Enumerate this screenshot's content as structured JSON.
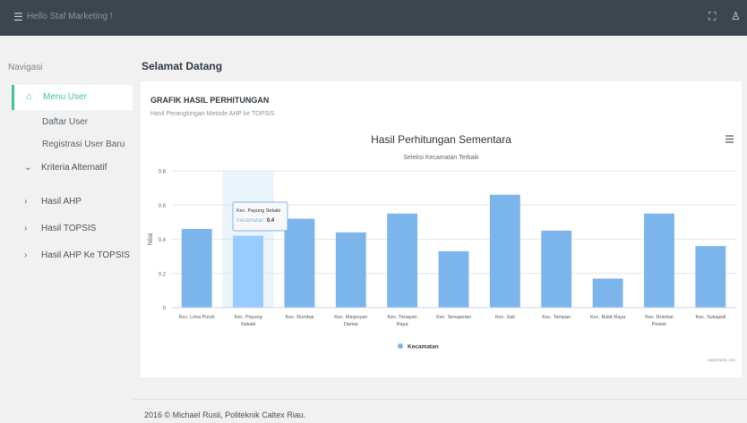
{
  "topbar": {
    "greeting": "Hello Staf Marketing !"
  },
  "sidebar": {
    "title": "Navigasi",
    "active": "Menu User",
    "subitems": [
      "Daftar User",
      "Registrasi User Baru"
    ],
    "items": [
      "Kriteria Alternatif",
      "Hasil AHP",
      "Hasil TOPSIS",
      "Hasil AHP Ke TOPSIS"
    ]
  },
  "page": {
    "title": "Selamat Datang"
  },
  "card": {
    "heading": "GRAFIK HASIL PERHITUNGAN",
    "subheading": "Hasil Perangkingan Metode AHP ke TOPSIS"
  },
  "chart_data": {
    "type": "bar",
    "title": "Hasil Perhitungan Sementara",
    "subtitle": "Seleksi Kecamatan Terbaik",
    "ylabel": "Nilai",
    "ylim": [
      0,
      0.8
    ],
    "yticks": [
      "0",
      "0.2",
      "0.4",
      "0.6",
      "0.8"
    ],
    "categories": [
      [
        "Kec. Lima Puluh"
      ],
      [
        "Kec. Payung",
        "Sekaki"
      ],
      [
        "Kec. Rumbai"
      ],
      [
        "Kec. Marpoyan",
        "Damai"
      ],
      [
        "Kec. Tenayan",
        "Raya"
      ],
      [
        "Kec. Senapelan"
      ],
      [
        "Kec. Sail"
      ],
      [
        "Kec. Tampan"
      ],
      [
        "Kec. Bukit Raya"
      ],
      [
        "Kec. Rumbai",
        "Pesisir"
      ],
      [
        "Kec. Sukajadi"
      ]
    ],
    "series": [
      {
        "name": "Kecamatan",
        "color": "#7cb5ec",
        "values": [
          0.46,
          0.42,
          0.52,
          0.44,
          0.55,
          0.33,
          0.66,
          0.45,
          0.17,
          0.55,
          0.36
        ]
      }
    ],
    "legend": "bottom-center",
    "tooltip": {
      "title": "Kec. Payung Sekaki",
      "series": "Kecamatan",
      "value": "0.4"
    },
    "credit": "Highcharts.com",
    "highlight_color": "#98cbff"
  },
  "footer": {
    "text": "2016 © Michael Rusli, Politeknik Caltex Riau."
  }
}
